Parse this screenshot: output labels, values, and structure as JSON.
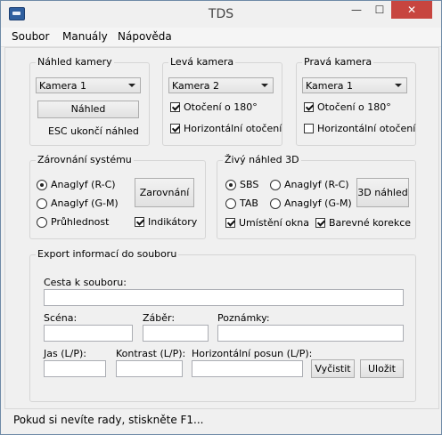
{
  "window": {
    "title": "TDS",
    "minimize": "—",
    "maximize": "☐",
    "close": "✕"
  },
  "menu": {
    "items": [
      "Soubor",
      "Manuály",
      "Nápověda"
    ]
  },
  "preview": {
    "label": "Náhled kamery",
    "camera_value": "Kamera 1",
    "button": "Náhled",
    "hint": "ESC ukončí náhled"
  },
  "left_camera": {
    "label": "Levá kamera",
    "camera_value": "Kamera 2",
    "rotate": "Otočení o 180°",
    "rotate_checked": true,
    "hflip": "Horizontální otočení",
    "hflip_checked": true
  },
  "right_camera": {
    "label": "Pravá kamera",
    "camera_value": "Kamera 1",
    "rotate": "Otočení o 180°",
    "rotate_checked": true,
    "hflip": "Horizontální otočení",
    "hflip_checked": false
  },
  "alignment": {
    "label": "Zárovnání systému",
    "options": [
      "Anaglyf (R-C)",
      "Anaglyf (G-M)",
      "Průhlednost"
    ],
    "selected": 0,
    "button": "Zarovnání",
    "indicators": "Indikátory",
    "indicators_checked": true
  },
  "live3d": {
    "label": "Živý náhled 3D",
    "modes": [
      "SBS",
      "TAB",
      "Anaglyf (R-C)",
      "Anaglyf (G-M)"
    ],
    "selected": 0,
    "button": "3D náhled",
    "window_placement": "Umístění okna",
    "window_placement_checked": true,
    "color_correction": "Barevné korekce",
    "color_correction_checked": true
  },
  "export": {
    "label": "Export informací do souboru",
    "path_label": "Cesta k souboru:",
    "path_value": "",
    "scene_label": "Scéna:",
    "scene_value": "",
    "shot_label": "Záběr:",
    "shot_value": "",
    "notes_label": "Poznámky:",
    "notes_value": "",
    "brightness_label": "Jas (L/P):",
    "brightness_value": "",
    "contrast_label": "Kontrast (L/P):",
    "contrast_value": "",
    "hshift_label": "Horizontální posun (L/P):",
    "hshift_value": "",
    "clear_button": "Vyčistit",
    "save_button": "Uložit"
  },
  "status": {
    "text": "Pokud si nevíte rady, stiskněte F1..."
  }
}
